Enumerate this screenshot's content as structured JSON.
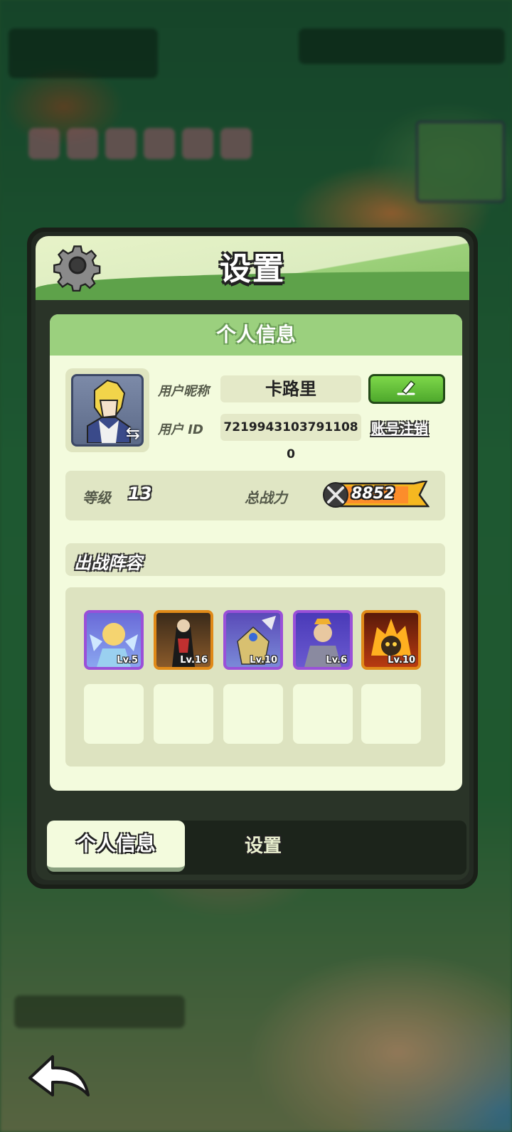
{
  "dialog": {
    "title": "设置",
    "section_title": "个人信息"
  },
  "profile": {
    "nickname_label": "用户昵称",
    "nickname_value": "卡路里",
    "id_label": "用户  ID",
    "id_value": "7219943103791108​0",
    "cancel_account_label": "账号注销",
    "level_label": "等级",
    "level_value": "13",
    "power_label": "总战力",
    "power_value": "8852"
  },
  "lineup": {
    "title": "出战阵容",
    "heroes": [
      {
        "level": "Lv.5"
      },
      {
        "level": "Lv.16"
      },
      {
        "level": "Lv.10"
      },
      {
        "level": "Lv.6"
      },
      {
        "level": "Lv.10"
      }
    ]
  },
  "tabs": {
    "active": "个人信息",
    "other": "设置"
  },
  "colors": {
    "accent_green": "#5ea24a",
    "card_bg": "#f3fbdd",
    "purple_frame": "#9a50d8",
    "gold_frame": "#e08a18"
  },
  "icons": {
    "settings": "gear-icon",
    "edit": "pencil-icon",
    "power": "crossed-swords-icon",
    "back": "back-arrow-icon",
    "avatar_swap": "swap-arrows-icon"
  }
}
